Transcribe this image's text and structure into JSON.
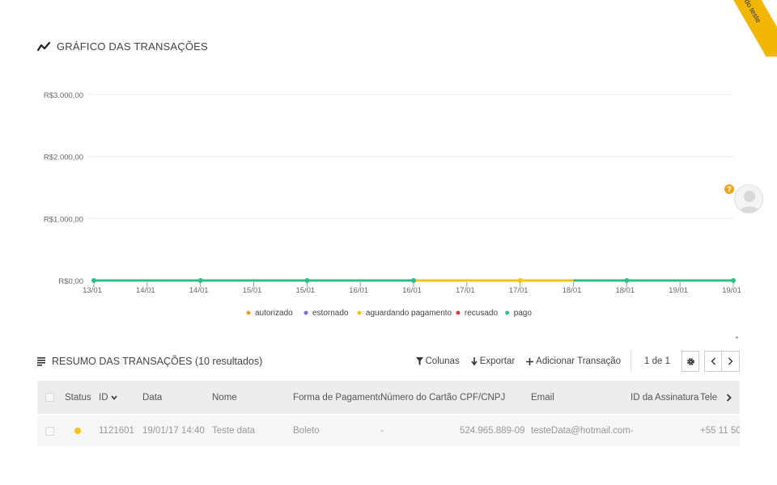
{
  "ribbon": {
    "label": "modo teste",
    "color": "#f2b705"
  },
  "chart_section": {
    "title": "GRÁFICO DAS TRANSAÇÕES",
    "icon": "line-chart-icon"
  },
  "chart_data": {
    "type": "line",
    "title": "GRÁFICO DAS TRANSAÇÕES",
    "x": [
      "13/01",
      "14/01",
      "14/01",
      "15/01",
      "15/01",
      "16/01",
      "16/01",
      "17/01",
      "17/01",
      "18/01",
      "18/01",
      "19/01",
      "19/01"
    ],
    "y_ticks": [
      "R$0,00",
      "R$1.000,00",
      "R$2.000,00",
      "R$3.000,00"
    ],
    "ylim": [
      0,
      3000
    ],
    "grid": true,
    "legend_position": "bottom",
    "series": [
      {
        "name": "autorizado",
        "color": "#f0962d",
        "points": []
      },
      {
        "name": "estornado",
        "color": "#7b6fd6",
        "points": []
      },
      {
        "name": "aguardando pagamento",
        "color": "#f2c51a",
        "points": [
          {
            "from": "16/01",
            "to": "18/01",
            "value": 0
          }
        ]
      },
      {
        "name": "recusado",
        "color": "#e8343c",
        "points": []
      },
      {
        "name": "pago",
        "color": "#2fbf84",
        "points": [
          {
            "from": "13/01",
            "to": "16/01",
            "value": 0
          },
          {
            "from": "18/01",
            "to": "19/01",
            "value": 0
          }
        ]
      }
    ]
  },
  "help_icon": {
    "icon": "question-icon",
    "glyph": "?"
  },
  "table_section": {
    "title": "RESUMO DAS TRANSAÇÕES (10 resultados)",
    "icon": "list-icon",
    "toolbar": {
      "columns_label": "Colunas",
      "columns_icon": "filter-icon",
      "export_label": "Exportar",
      "export_icon": "download-icon",
      "add_label": "Adicionar Transação",
      "add_icon": "plus-icon"
    },
    "pagination": {
      "text": "1 de 1",
      "settings_icon": "gear-icon",
      "prev_icon": "chevron-left-icon",
      "next_icon": "chevron-right-icon"
    },
    "columns": [
      "Status",
      "ID",
      "Data",
      "Nome",
      "Forma de Pagamento",
      "Número do Cartão",
      "CPF/CNPJ",
      "Email",
      "ID da Assinatura",
      "Tele"
    ],
    "rows": [
      {
        "status_color": "#f2c51a",
        "id": "1121601",
        "data": "19/01/17 14:40",
        "nome": "Teste data",
        "forma": "Boleto",
        "cartao": "-",
        "cpf": "524.965.889-09",
        "email": "testeData@hotmail.com",
        "assinatura": "-",
        "telefone": "+55 11 50"
      }
    ]
  }
}
